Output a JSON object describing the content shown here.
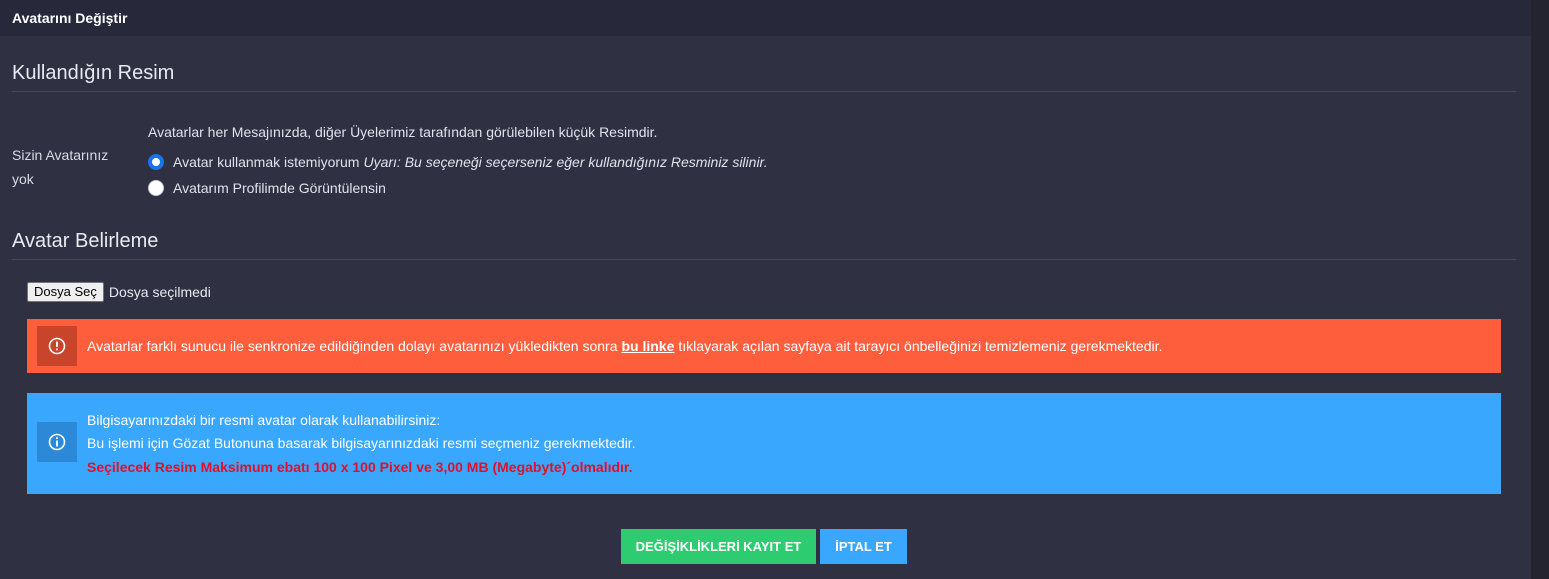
{
  "panel": {
    "title": "Avatarını Değiştir"
  },
  "current": {
    "section_title": "Kullandığın Resim",
    "field_label": "Sizin Avatarınız yok",
    "description": "Avatarlar her Mesajınızda, diğer Üyelerimiz tarafından görülebilen küçük Resimdir.",
    "options": [
      {
        "label": "Avatar kullanmak istemiyorum",
        "warning": "Uyarı: Bu seçeneği seçerseniz eğer kullandığınız Resminiz silinir.",
        "checked": true
      },
      {
        "label": "Avatarım Profilimde Görüntülensin",
        "warning": "",
        "checked": false
      }
    ]
  },
  "upload": {
    "section_title": "Avatar Belirleme",
    "file_button": "Dosya Seç",
    "file_status": "Dosya seçilmedi"
  },
  "alerts": {
    "danger": {
      "icon": "exclamation-circle-icon",
      "text_before": "Avatarlar farklı sunucu ile senkronize edildiğinden dolayı avatarınızı yükledikten sonra",
      "link": "bu linke",
      "text_after": "tıklayarak açılan sayfaya ait tarayıcı önbelleğinizi temizlemeniz gerekmektedir.",
      "color": "#ff5e3d"
    },
    "info": {
      "icon": "info-circle-icon",
      "line1": "Bilgisayarınızdaki bir resmi avatar olarak kullanabilirsiniz:",
      "line2": "Bu işlemi için Gözat Butonuna basarak bilgisayarınızdaki resmi seçmeniz gerekmektedir.",
      "line3": "Seçilecek Resim Maksimum ebatı 100 x 100 Pixel ve 3,00 MB (Megabyte)´olmalıdır.",
      "color": "#3aa7ff"
    }
  },
  "actions": {
    "save": "DEĞİŞİKLİKLERİ KAYIT ET",
    "cancel": "İPTAL ET"
  }
}
